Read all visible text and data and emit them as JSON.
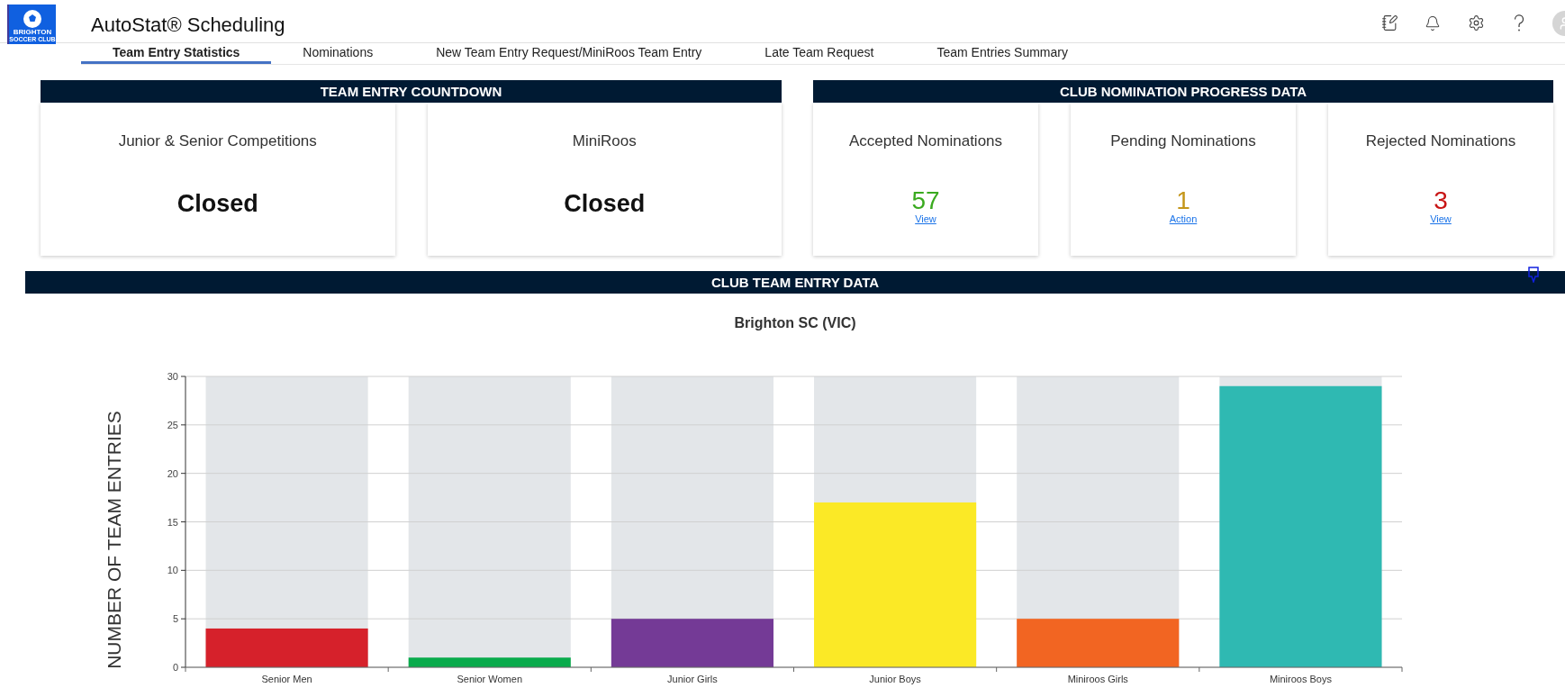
{
  "header": {
    "logo_text": [
      "BRIGHTON",
      "SOCCER CLUB"
    ],
    "title": "AutoStat® Scheduling"
  },
  "tabs": [
    {
      "label": "Team Entry Statistics",
      "selected": true
    },
    {
      "label": "Nominations",
      "selected": false
    },
    {
      "label": "New Team Entry Request/MiniRoos Team Entry",
      "selected": false
    },
    {
      "label": "Late Team Request",
      "selected": false
    },
    {
      "label": "Team Entries Summary",
      "selected": false
    }
  ],
  "countdown": {
    "title": "TEAM ENTRY COUNTDOWN",
    "cards": [
      {
        "label": "Junior & Senior Competitions",
        "value": "Closed"
      },
      {
        "label": "MiniRoos",
        "value": "Closed"
      }
    ]
  },
  "nominations": {
    "title": "CLUB NOMINATION PROGRESS DATA",
    "cards": [
      {
        "label": "Accepted Nominations",
        "value": "57",
        "link": "View",
        "color": "#3aaa1f"
      },
      {
        "label": "Pending Nominations",
        "value": "1",
        "link": "Action",
        "color": "#c4961a"
      },
      {
        "label": "Rejected Nominations",
        "value": "3",
        "link": "View",
        "color": "#c81414"
      }
    ]
  },
  "team_entry": {
    "title": "CLUB TEAM ENTRY DATA",
    "chart_data": {
      "type": "bar",
      "title": "Brighton SC (VIC)",
      "ylabel": "NUMBER OF TEAM ENTRIES",
      "categories": [
        "Senior Men",
        "Senior Women",
        "Junior Girls",
        "Junior Boys",
        "Miniroos Girls",
        "Miniroos Boys"
      ],
      "values": [
        4,
        1,
        5,
        17,
        5,
        29
      ],
      "colors": [
        "#d6212b",
        "#0aab4c",
        "#743a96",
        "#fbe926",
        "#f26522",
        "#2fb9b2"
      ],
      "ylim": [
        0,
        30
      ],
      "grid": true,
      "yticks": [
        0,
        5,
        10,
        15,
        20,
        25,
        30
      ]
    }
  }
}
